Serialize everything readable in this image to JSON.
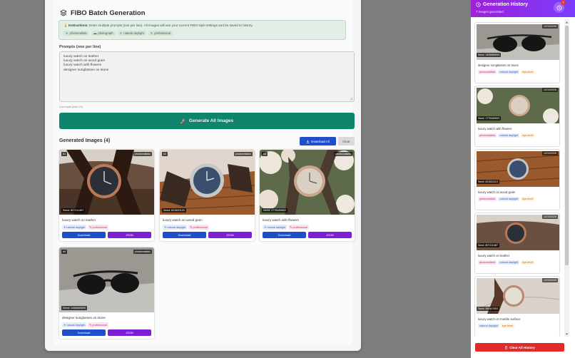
{
  "app": {
    "title": "FIBO Batch Generation"
  },
  "instructions": {
    "label": "Instructions:",
    "text": "Enter multiple prompts (one per line). All images will use your current FIBO style settings and be saved to history.",
    "tags": [
      "photorealistic",
      "photograph",
      "natural daylight",
      "professional"
    ]
  },
  "prompts": {
    "label": "Prompts (one per line)",
    "lines": [
      "luxury watch on leather",
      "luxury watch on wood grain",
      "luxury watch with flowers",
      "designer sunglasses on stone"
    ],
    "count": "4 prompts (max 20)"
  },
  "generate_label": "Generate All Images",
  "results": {
    "title": "Generated Images (4)",
    "download_all": "Download All",
    "clear": "Clear",
    "items": [
      {
        "num": "#1",
        "style": "photorealistic",
        "seed": "Seed: 807111487",
        "caption": "luxury watch on leather",
        "tags": [
          "natural daylight",
          "professional"
        ]
      },
      {
        "num": "#2",
        "style": "photorealistic",
        "seed": "Seed: 621620121",
        "caption": "luxury watch on wood grain",
        "tags": [
          "natural daylight",
          "professional"
        ]
      },
      {
        "num": "#3",
        "style": "photorealistic",
        "seed": "Seed: 1775489822",
        "caption": "luxury watch with flowers",
        "tags": [
          "natural daylight",
          "professional"
        ]
      },
      {
        "num": "#4",
        "style": "photorealistic",
        "seed": "Seed: 1406689693",
        "caption": "designer sunglasses on stone",
        "tags": [
          "natural daylight",
          "professional"
        ]
      }
    ],
    "download": "Download",
    "json": "JSON"
  },
  "history": {
    "title": "Generation History",
    "count": "7 images generated",
    "badge": "7",
    "clear_label": "Clear All History",
    "items": [
      {
        "date": "12/10/2025",
        "seed": "Seed: 1406689693",
        "name": "designer sunglasses on stone",
        "tags": [
          "photorealistic",
          "natural daylight",
          "eye-level"
        ]
      },
      {
        "date": "12/10/2025",
        "seed": "Seed: 1775489822",
        "name": "luxury watch with flowers",
        "tags": [
          "photorealistic",
          "natural daylight",
          "eye-level"
        ]
      },
      {
        "date": "12/10/2025",
        "seed": "Seed: 621620121",
        "name": "luxury watch on wood grain",
        "tags": [
          "photorealistic",
          "natural daylight",
          "eye-level"
        ]
      },
      {
        "date": "12/10/2025",
        "seed": "Seed: 807111487",
        "name": "luxury watch on leather",
        "tags": [
          "photorealistic",
          "natural daylight",
          "eye-level"
        ]
      },
      {
        "date": "12/10/2025",
        "seed": "Seed: 580457853",
        "name": "luxury watch on marble surface",
        "tags": [
          "natural daylight",
          "eye-level"
        ]
      }
    ]
  },
  "colors": {
    "generate": "#10856d",
    "download": "#1d4fc9",
    "json": "#7c1fd4",
    "clear_history": "#e12b2b",
    "history_header": "#8f2be6"
  }
}
